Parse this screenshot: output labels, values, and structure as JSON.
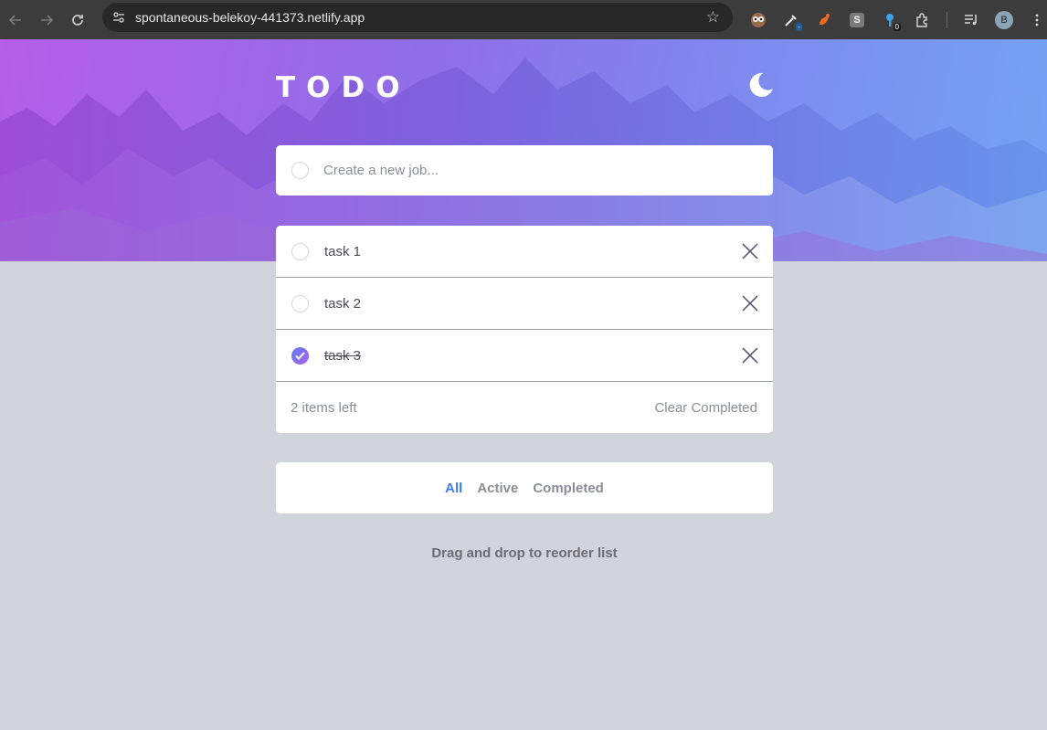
{
  "browser": {
    "url": "spontaneous-belekoy-441373.netlify.app",
    "avatar_letter": "B",
    "extensions": [
      {
        "icon": "owl-extension-icon"
      },
      {
        "icon": "eyedropper-extension-icon",
        "badge": "-"
      },
      {
        "icon": "orange-extension-icon"
      },
      {
        "icon": "s-extension-icon",
        "letter": "S"
      },
      {
        "icon": "key-extension-icon",
        "badge": "0"
      },
      {
        "icon": "puzzle-extensions-icon"
      },
      {
        "icon": "media-control-icon"
      }
    ]
  },
  "app": {
    "title": "TODO",
    "new_job_placeholder": "Create a new job...",
    "tasks": [
      {
        "text": "task 1",
        "completed": false
      },
      {
        "text": "task 2",
        "completed": false
      },
      {
        "text": "task 3",
        "completed": true
      }
    ],
    "items_left": "2 items left",
    "clear_completed": "Clear Completed",
    "filters": [
      "All",
      "Active",
      "Completed"
    ],
    "active_filter": "All",
    "hint": "Drag and drop to reorder list"
  },
  "colors": {
    "accent": "#3a7bfd",
    "gradient_start": "#5c7cf6",
    "gradient_end": "#b35eea",
    "background": "#d1d4da"
  }
}
